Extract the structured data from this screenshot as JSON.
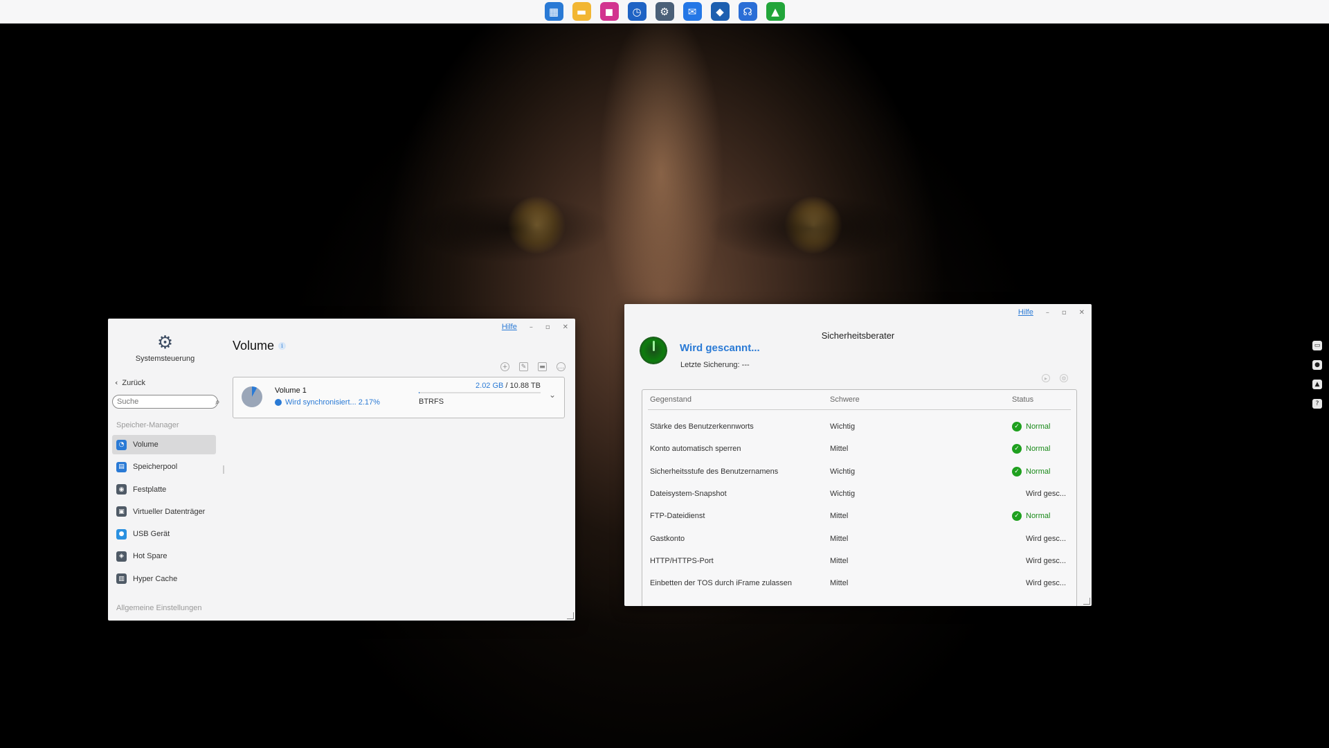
{
  "taskbar": {
    "apps": [
      {
        "name": "desktop-app",
        "glyph": "▦",
        "color": "#2a7ad5"
      },
      {
        "name": "file-manager",
        "glyph": "▬",
        "color": "#f2b632"
      },
      {
        "name": "media-app",
        "glyph": "◼",
        "color": "#d2338f"
      },
      {
        "name": "backup-app",
        "glyph": "◷",
        "color": "#1f63c4"
      },
      {
        "name": "settings-app",
        "glyph": "⚙",
        "color": "#4b6078"
      },
      {
        "name": "mail-app",
        "glyph": "✉",
        "color": "#2477e6"
      },
      {
        "name": "security-app",
        "glyph": "◆",
        "color": "#1d5fb0"
      },
      {
        "name": "support-app",
        "glyph": "☊",
        "color": "#2b6ed6"
      },
      {
        "name": "advisor-app",
        "glyph": "▲",
        "color": "#22a53a"
      }
    ]
  },
  "system_window": {
    "help": "Hilfe",
    "app_title": "Systemsteuerung",
    "back": "Zurück",
    "search_placeholder": "Suche",
    "section_storage": "Speicher-Manager",
    "section_general": "Allgemeine Einstellungen",
    "nav": [
      {
        "label": "Volume",
        "icon": "volume-icon",
        "color": "#2a7ad5",
        "glyph": "◔",
        "active": true
      },
      {
        "label": "Speicherpool",
        "icon": "storage-pool-icon",
        "color": "#2a7ad5",
        "glyph": "▤",
        "active": false
      },
      {
        "label": "Festplatte",
        "icon": "hard-disk-icon",
        "color": "#4f5a66",
        "glyph": "◉",
        "active": false
      },
      {
        "label": "Virtueller Datenträger",
        "icon": "virtual-disk-icon",
        "color": "#4f5a66",
        "glyph": "▣",
        "active": false
      },
      {
        "label": "USB Gerät",
        "icon": "usb-icon",
        "color": "#2a90e0",
        "glyph": "●",
        "active": false
      },
      {
        "label": "Hot Spare",
        "icon": "hot-spare-icon",
        "color": "#4f5a66",
        "glyph": "◈",
        "active": false
      },
      {
        "label": "Hyper Cache",
        "icon": "hyper-cache-icon",
        "color": "#4f5a66",
        "glyph": "▥",
        "active": false
      }
    ],
    "page_title": "Volume",
    "volume": {
      "name": "Volume 1",
      "sync_status": "Wird synchronisiert... 2.17%",
      "used": "2.02 GB",
      "separator": " / ",
      "total": "10.88 TB",
      "usage_fraction": 0.0002,
      "filesystem": "BTRFS"
    }
  },
  "security_window": {
    "help": "Hilfe",
    "title": "Sicherheitsberater",
    "scan_status": "Wird gescannt...",
    "last_backup": "Letzte Sicherung: ---",
    "columns": [
      "Gegenstand",
      "Schwere",
      "Status"
    ],
    "rows": [
      {
        "item": "Stärke des Benutzerkennworts",
        "severity": "Wichtig",
        "status": "Normal",
        "ok": true
      },
      {
        "item": "Konto automatisch sperren",
        "severity": "Mittel",
        "status": "Normal",
        "ok": true
      },
      {
        "item": "Sicherheitsstufe des Benutzernamens",
        "severity": "Wichtig",
        "status": "Normal",
        "ok": true
      },
      {
        "item": "Dateisystem-Snapshot",
        "severity": "Wichtig",
        "status": "Wird gesc...",
        "ok": false
      },
      {
        "item": "FTP-Dateidienst",
        "severity": "Mittel",
        "status": "Normal",
        "ok": true
      },
      {
        "item": "Gastkonto",
        "severity": "Mittel",
        "status": "Wird gesc...",
        "ok": false
      },
      {
        "item": "HTTP/HTTPS-Port",
        "severity": "Mittel",
        "status": "Wird gesc...",
        "ok": false
      },
      {
        "item": "Einbetten der TOS durch iFrame zulassen",
        "severity": "Mittel",
        "status": "Wird gesc...",
        "ok": false
      }
    ]
  },
  "colors": {
    "accent": "#2a7ad5",
    "ok_green": "#1fa01f"
  }
}
